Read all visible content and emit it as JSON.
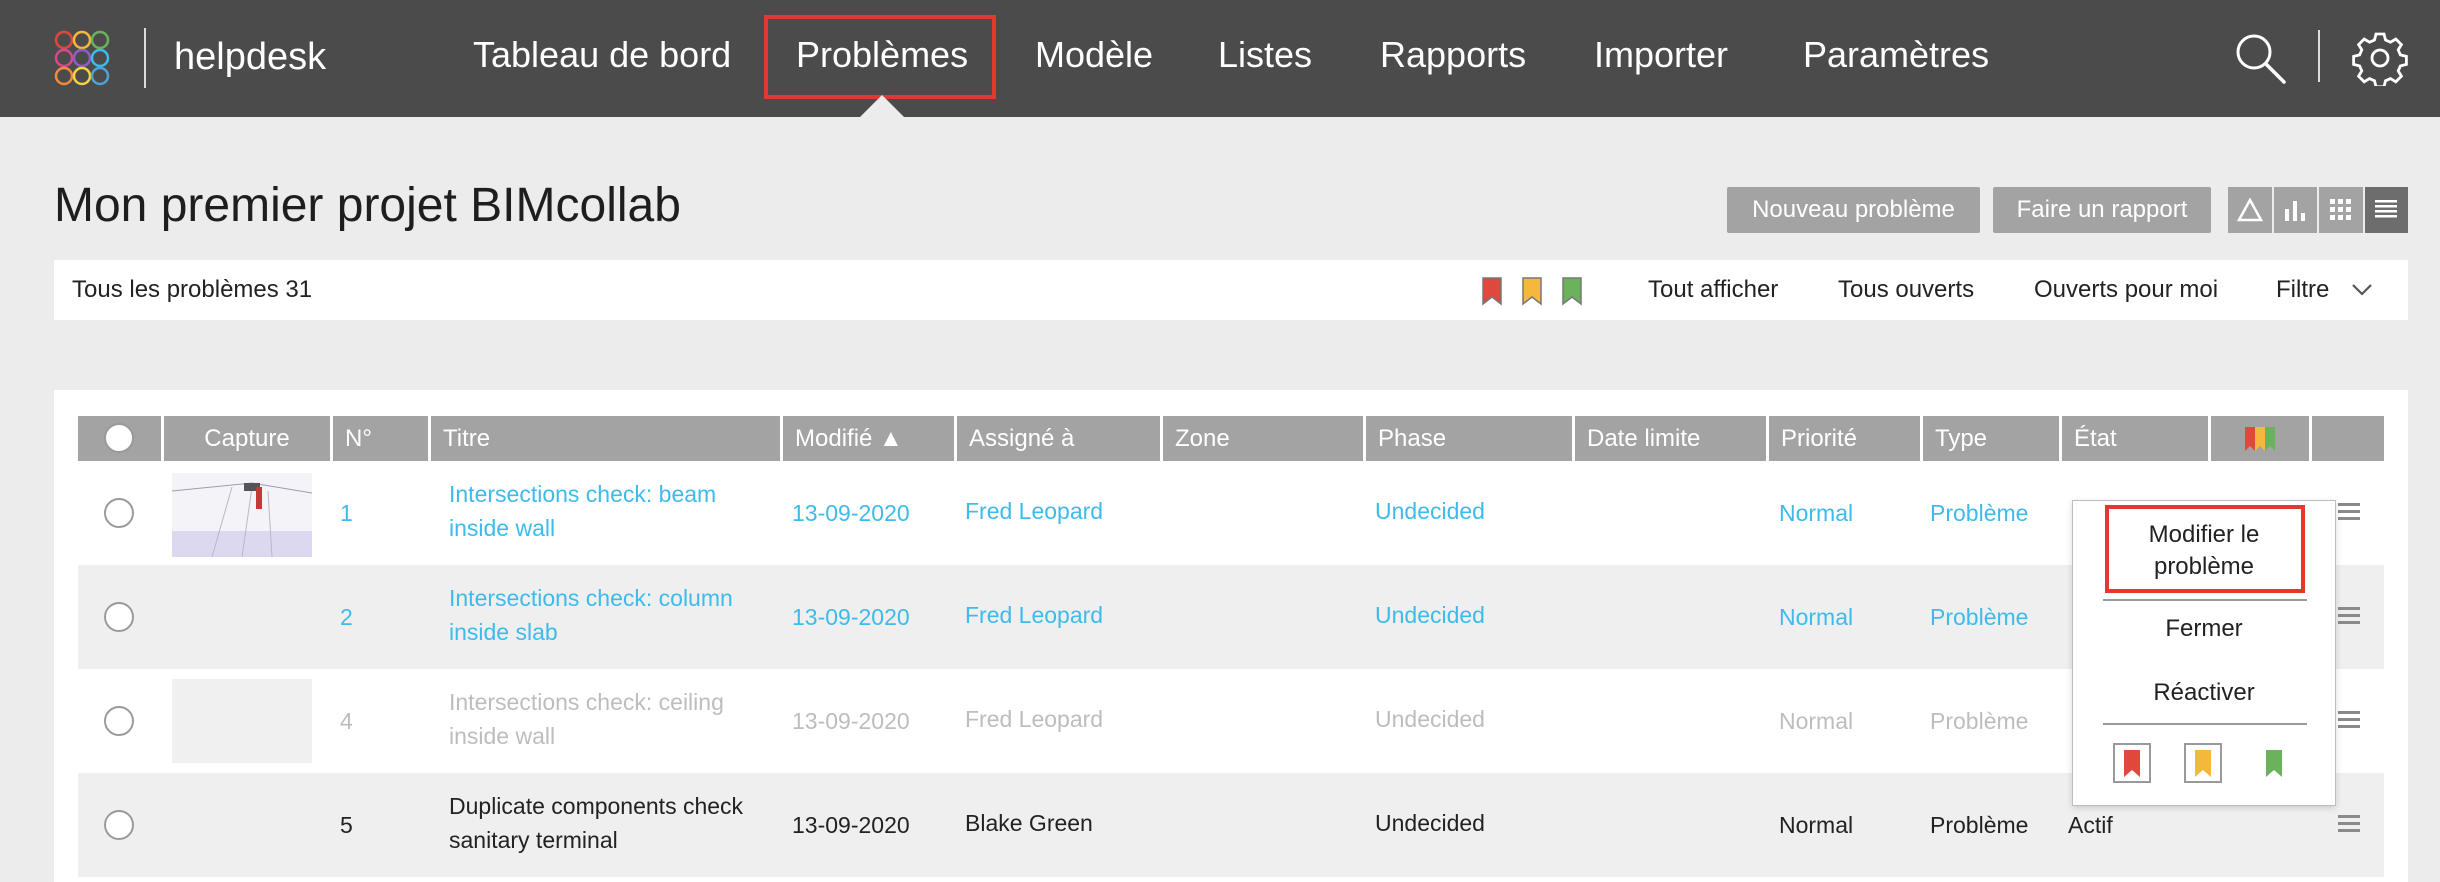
{
  "app": {
    "brand": "helpdesk"
  },
  "nav": {
    "items": [
      "Tableau de bord",
      "Problèmes",
      "Modèle",
      "Listes",
      "Rapports",
      "Importer",
      "Paramètres"
    ],
    "active": "Problèmes"
  },
  "page": {
    "title": "Mon premier projet BIMcollab",
    "new_issue_label": "Nouveau problème",
    "report_label": "Faire un rapport"
  },
  "filters": {
    "count_label": "Tous les problèmes 31",
    "show_all": "Tout afficher",
    "all_open": "Tous ouverts",
    "open_for_me": "Ouverts pour moi",
    "filter": "Filtre"
  },
  "colors": {
    "red": "#e0483e",
    "orange": "#f6b83c",
    "green": "#6ab35c",
    "link": "#3dbbeb",
    "highlight": "#e3382f"
  },
  "table": {
    "headers": [
      "Capture",
      "N°",
      "Titre",
      "Modifié ▲",
      "Assigné à",
      "Zone",
      "Phase",
      "Date limite",
      "Priorité",
      "Type",
      "État"
    ],
    "rows": [
      {
        "num": "1",
        "title": "Intersections check: beam inside wall",
        "modified": "13-09-2020",
        "assignee": "Fred Leopard",
        "phase": "Undecided",
        "priority": "Normal",
        "type": "Problème",
        "state": ""
      },
      {
        "num": "2",
        "title": "Intersections check: column inside slab",
        "modified": "13-09-2020",
        "assignee": "Fred Leopard",
        "phase": "Undecided",
        "priority": "Normal",
        "type": "Problème",
        "state": ""
      },
      {
        "num": "4",
        "title": "Intersections check: ceiling inside wall",
        "modified": "13-09-2020",
        "assignee": "Fred Leopard",
        "phase": "Undecided",
        "priority": "Normal",
        "type": "Problème",
        "state": ""
      },
      {
        "num": "5",
        "title": "Duplicate components check sanitary terminal",
        "modified": "13-09-2020",
        "assignee": "Blake Green",
        "phase": "Undecided",
        "priority": "Normal",
        "type": "Problème",
        "state": "Actif"
      }
    ]
  },
  "context_menu": {
    "edit": "Modifier le problème",
    "close": "Fermer",
    "reactivate": "Réactiver"
  }
}
